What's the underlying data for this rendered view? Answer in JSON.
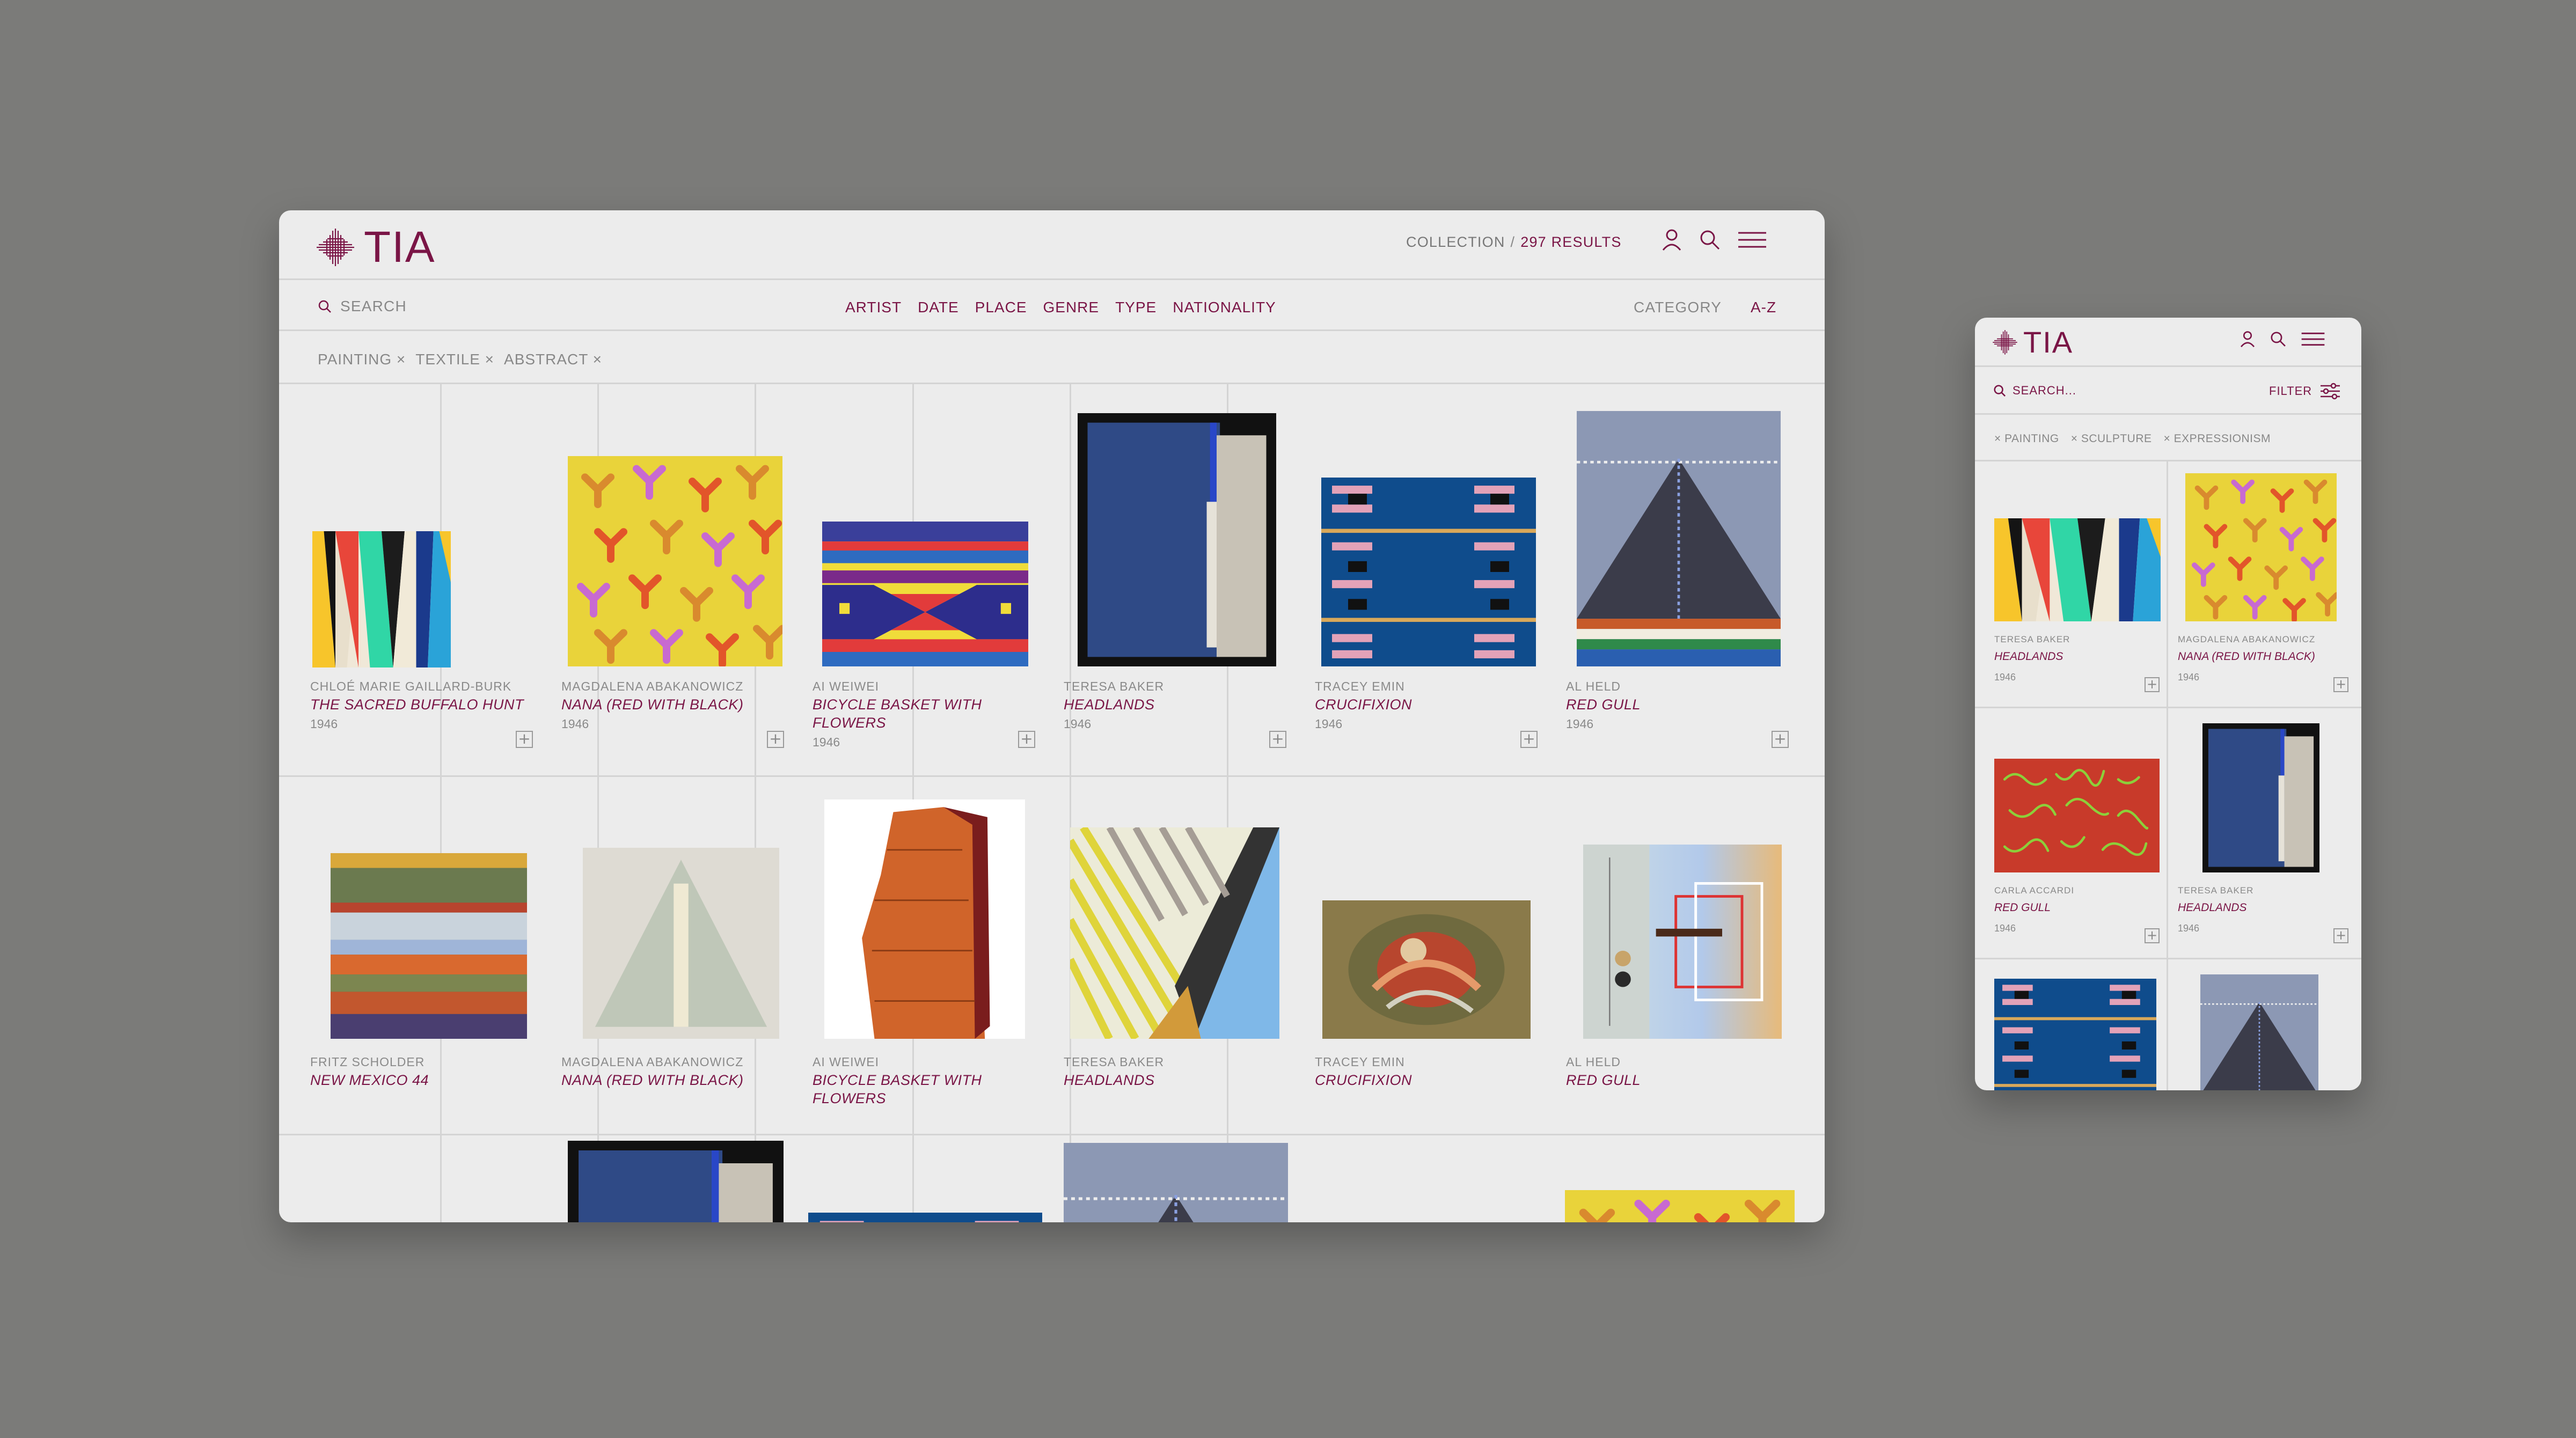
{
  "brand": {
    "name": "TIA",
    "accent": "#7a1546"
  },
  "desktop": {
    "breadcrumb": {
      "section": "COLLECTION",
      "separator": "/",
      "results": "297 RESULTS"
    },
    "icons": [
      "user-icon",
      "search-icon",
      "menu-icon"
    ],
    "search_label": "SEARCH",
    "filters": [
      "ARTIST",
      "DATE",
      "PLACE",
      "GENRE",
      "TYPE",
      "NATIONALITY"
    ],
    "category_label": "CATEGORY",
    "sort_label": "A-Z",
    "active_tags": [
      "PAINTING ×",
      "TEXTILE ×",
      "ABSTRACT ×"
    ],
    "row1": [
      {
        "artist": "CHLOÉ MARIE GAILLARD-BURK",
        "title": "THE SACRED BUFFALO HUNT",
        "year": "1946"
      },
      {
        "artist": "MAGDALENA ABAKANOWICZ",
        "title": "NANA (RED WITH BLACK)",
        "year": "1946"
      },
      {
        "artist": "AI WEIWEI",
        "title": "BICYCLE BASKET WITH FLOWERS",
        "year": "1946"
      },
      {
        "artist": "TERESA BAKER",
        "title": "HEADLANDS",
        "year": "1946"
      },
      {
        "artist": "TRACEY EMIN",
        "title": "CRUCIFIXION",
        "year": "1946"
      },
      {
        "artist": "AL HELD",
        "title": "RED GULL",
        "year": "1946"
      }
    ],
    "row2": [
      {
        "artist": "FRITZ SCHOLDER",
        "title": "NEW MEXICO 44"
      },
      {
        "artist": "MAGDALENA ABAKANOWICZ",
        "title": "NANA (RED WITH BLACK)"
      },
      {
        "artist": "AI WEIWEI",
        "title": "BICYCLE BASKET WITH FLOWERS"
      },
      {
        "artist": "TERESA BAKER",
        "title": "HEADLANDS"
      },
      {
        "artist": "TRACEY EMIN",
        "title": "CRUCIFIXION"
      },
      {
        "artist": "AL HELD",
        "title": "RED GULL"
      }
    ],
    "add_symbol": "+"
  },
  "mobile": {
    "search_placeholder": "SEARCH...",
    "filter_label": "FILTER",
    "active_tags": [
      "× PAINTING",
      "× SCULPTURE",
      "× EXPRESSIONISM"
    ],
    "items": [
      {
        "artist": "TERESA BAKER",
        "title": "HEADLANDS",
        "year": "1946"
      },
      {
        "artist": "MAGDALENA ABAKANOWICZ",
        "title": "NANA (RED WITH BLACK)",
        "year": "1946"
      },
      {
        "artist": "CARLA ACCARDI",
        "title": "RED GULL",
        "year": "1946"
      },
      {
        "artist": "TERESA BAKER",
        "title": "HEADLANDS",
        "year": "1946"
      }
    ]
  }
}
